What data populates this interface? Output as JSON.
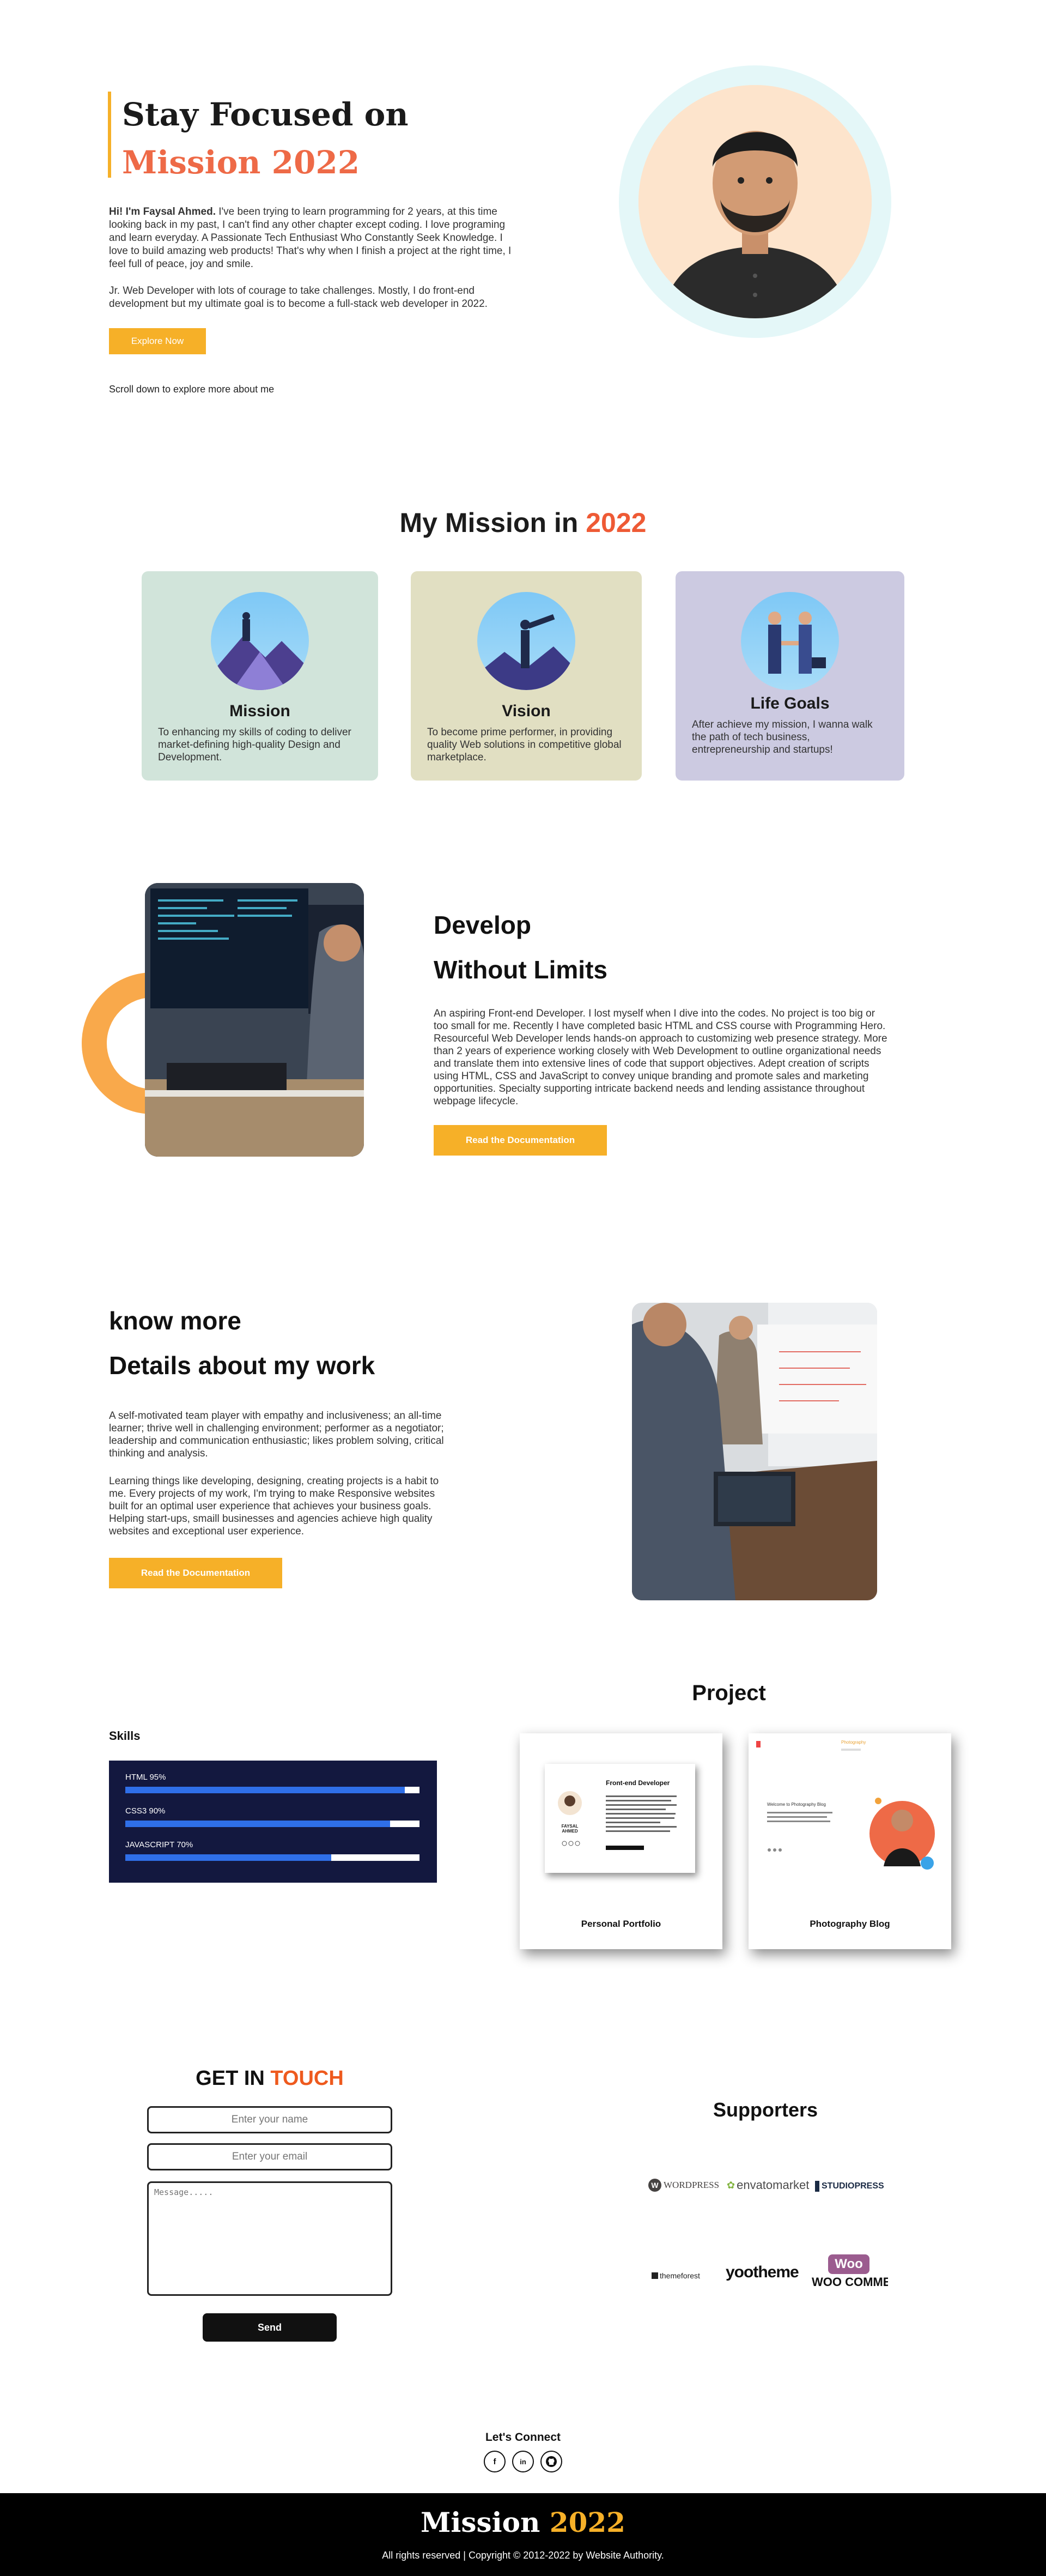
{
  "hero": {
    "title_line1": "Stay Focused on",
    "title_line2": "Mission 2022",
    "intro_bold": "Hi! I'm Faysal Ahmed.",
    "intro_rest": " I've been trying to learn programming for 2 years, at this time looking back in my past, I can't find any other chapter except coding. I love programing and learn everyday. A Passionate Tech Enthusiast Who Constantly Seek Knowledge. I love to build amazing web products! That's why when I finish a project at the right time, I feel full of peace, joy and smile.",
    "intro_p2": "Jr. Web Developer with lots of courage to take challenges. Mostly, I do front-end development but my ultimate goal is to become a full-stack web developer in 2022.",
    "explore_label": "Explore Now",
    "scroll_hint": "Scroll down to explore more about me"
  },
  "mission": {
    "title_pre": "My Mission in ",
    "title_accent": "2022",
    "cards": [
      {
        "title": "Mission",
        "text": "To enhancing my skills of coding to deliver market-defining high-quality Design and Development.",
        "bg": "#d1e4da"
      },
      {
        "title": "Vision",
        "text": "To become prime performer, in providing quality Web solutions in competitive global marketplace.",
        "bg": "#e1dfc2"
      },
      {
        "title": "Life Goals",
        "text": "After achieve my mission, I wanna walk the path of tech business, entrepreneurship and startups!",
        "bg": "#cccae1"
      }
    ]
  },
  "develop": {
    "heading1": "Develop",
    "heading2": "Without Limits",
    "text": "An aspiring Front-end Developer. I lost myself when I dive into the codes. No project is too big or too small for me. Recently I have completed basic HTML and CSS course with Programming Hero. Resourceful Web Developer lends hands-on approach to customizing web presence strategy. More than 2 years of experience working closely with Web Development to outline organizational needs and translate them into extensive lines of code that support objectives. Adept creation of scripts using HTML, CSS and JavaScript to convey unique branding and promote sales and marketing opportunities. Specialty supporting intricate backend needs and lending assistance throughout webpage lifecycle.",
    "button_label": "Read the Documentation"
  },
  "knowmore": {
    "heading1": "know more",
    "heading2": "Details about my work",
    "p1": "A self-motivated team player with empathy and inclusiveness; an all-time learner; thrive well in challenging environment; performer as a negotiator; leadership and communication enthusiastic; likes problem solving, critical thinking and analysis.",
    "p2": "Learning things like developing, designing, creating projects is a habit to me. Every projects of my work, I'm trying to make Responsive websites built for an optimal user experience that achieves your business goals. Helping start-ups, smaill businesses and agencies achieve high quality websites and exceptional user experience.",
    "button_label": "Read the Documentation"
  },
  "skills": {
    "title": "Skills",
    "items": [
      {
        "label": "HTML 95%",
        "percent": 95
      },
      {
        "label": "CSS3 90%",
        "percent": 90
      },
      {
        "label": "JAVASCRIPT 70%",
        "percent": 70
      }
    ]
  },
  "projects": {
    "title": "Project",
    "items": [
      {
        "label": "Personal Portfolio",
        "thumb_heading": "Front-end Developer",
        "thumb_name": "FAYSAL AHMED"
      },
      {
        "label": "Photography Blog",
        "thumb_heading": "Welcome to Photography Blog",
        "thumb_name": "Photography"
      }
    ]
  },
  "contact": {
    "title_pre": "GET IN ",
    "title_accent": "TOUCH",
    "name_placeholder": "Enter your name",
    "email_placeholder": "Enter your email",
    "message_placeholder": "Message.....",
    "send_label": "Send"
  },
  "supporters": {
    "title": "Supporters",
    "logos": [
      {
        "name": "WORDPRESS",
        "icon": "wordpress-logo"
      },
      {
        "name": "envatomarket",
        "icon": "envato-logo"
      },
      {
        "name": "STUDIOPRESS",
        "icon": "studiopress-logo"
      },
      {
        "name": "themeforest",
        "icon": "themeforest-logo"
      },
      {
        "name": "yootheme",
        "icon": "yootheme-logo"
      },
      {
        "name": "WOO COMMERCE",
        "icon": "woocommerce-logo"
      }
    ]
  },
  "connect": {
    "title": "Let's Connect",
    "icons": [
      "facebook-icon",
      "linkedin-icon",
      "github-icon"
    ]
  },
  "footer": {
    "brand_pre": "Mission ",
    "brand_accent": "2022",
    "copyright": "All rights reserved | Copyright © 2012-2022 by Website Authority."
  },
  "colors": {
    "accent_orange": "#f6b028",
    "accent_red": "#ee6a47",
    "skills_bg": "#13183f",
    "skill_fill": "#2f6fe8"
  }
}
